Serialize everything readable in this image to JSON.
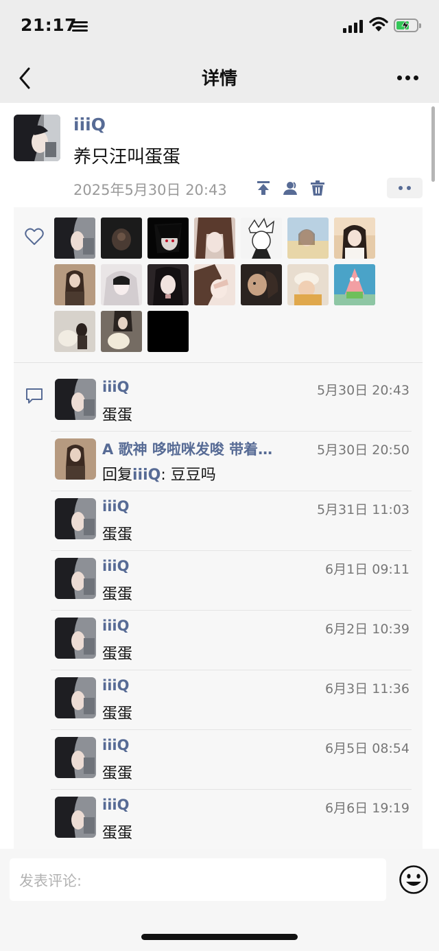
{
  "status_bar": {
    "time": "21:17"
  },
  "nav": {
    "title": "详情"
  },
  "post": {
    "author": "iiiQ",
    "text": "养只汪叫蛋蛋",
    "timestamp": "2025年5月30日 20:43",
    "likes_count_shown": 17
  },
  "comments": [
    {
      "name": "iiiQ",
      "time": "5月30日 20:43",
      "text": "蛋蛋"
    },
    {
      "name": "A 歌神 哆啦咪发唆 带着…",
      "time": "5月30日 20:50",
      "reply_prefix": "回复",
      "reply_to": "iiiQ",
      "reply_text": ": 豆豆吗"
    },
    {
      "name": "iiiQ",
      "time": "5月31日 11:03",
      "text": "蛋蛋"
    },
    {
      "name": "iiiQ",
      "time": "6月1日 09:11",
      "text": "蛋蛋"
    },
    {
      "name": "iiiQ",
      "time": "6月2日 10:39",
      "text": "蛋蛋"
    },
    {
      "name": "iiiQ",
      "time": "6月3日 11:36",
      "text": "蛋蛋"
    },
    {
      "name": "iiiQ",
      "time": "6月5日 08:54",
      "text": "蛋蛋"
    },
    {
      "name": "iiiQ",
      "time": "6月6日 19:19",
      "text": "蛋蛋"
    }
  ],
  "input": {
    "placeholder": "发表评论:"
  },
  "icons": {
    "back": "chevron-left-icon",
    "more": "more-dots-icon",
    "pin": "pin-top-icon",
    "visibility": "contacts-icon",
    "delete": "trash-icon",
    "like": "heart-outline-icon",
    "comment": "comment-bubble-icon",
    "emoji": "emoji-face-icon"
  },
  "colors": {
    "link_blue": "#576b95",
    "background": "#ededed",
    "panel": "#f7f7f7",
    "battery_green": "#34c759"
  }
}
